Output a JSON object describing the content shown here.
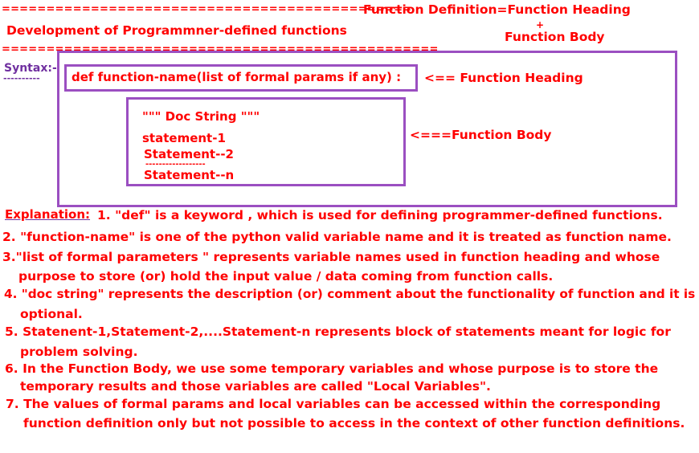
{
  "header": {
    "equals_line_1": "==============================================",
    "function_definition": "Function Definition=Function Heading",
    "plus": "+",
    "function_body": "Function Body",
    "title": "Development of Programmner-defined functions",
    "equals_line_2": "================================================="
  },
  "syntax": {
    "label": "Syntax:-",
    "label_underline": "----------",
    "heading_code": "def    function-name(list of formal params if any) :",
    "heading_arrow": "<== Function Heading",
    "doc_string": "\"\"\" Doc String \"\"\"",
    "statement_1": "statement-1",
    "statement_2": "Statement--2",
    "dashes": "------------------",
    "statement_n": "Statement--n",
    "body_arrow": "<===Function Body"
  },
  "explanation": {
    "label": "Explanation:",
    "lines": [
      "1. \"def\" is a keyword , which is used for defining programmer-defined functions.",
      "2. \"function-name\" is one of the python valid variable name and it is treated as function name.",
      "3.\"list of formal parameters \" represents variable names used in function heading and whose",
      "purpose to store (or) hold the input value / data coming from function calls.",
      "4. \"doc string\" represents the description (or) comment  about the functionality of function and it is",
      "optional.",
      "5. Statenent-1,Statement-2,....Statement-n represents block of statements meant for logic for",
      "problem solving.",
      "6. In the Function Body, we use some temporary variables and whose purpose is to store the",
      "temporary results and those variables are  called \"Local Variables\".",
      "7. The values of formal params and local variables can be accessed within the corresponding",
      "function definition only but not possible to access in the context of other function definitions."
    ]
  },
  "colors": {
    "red": "#ff0000",
    "purple": "#7030a0",
    "box_border": "#9b4fc1"
  }
}
